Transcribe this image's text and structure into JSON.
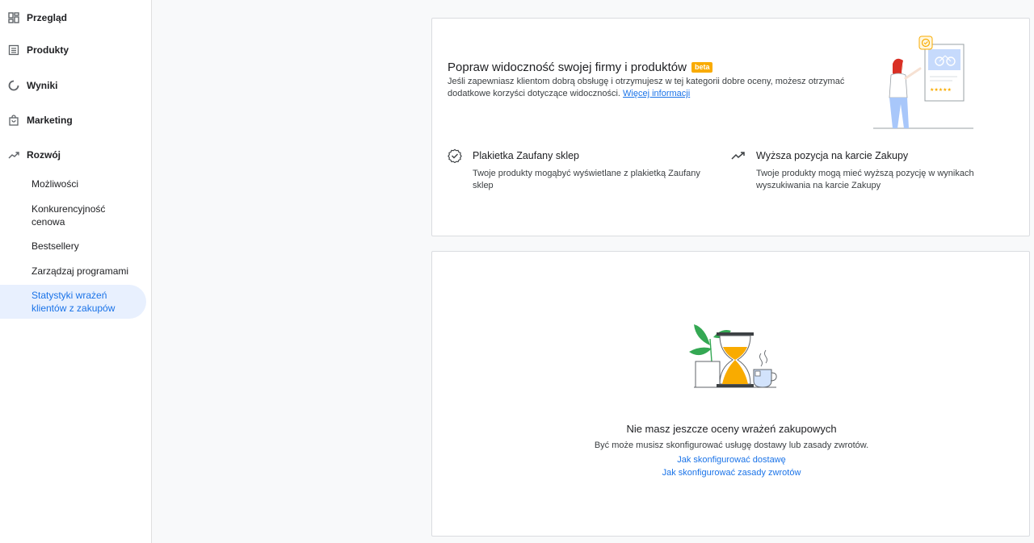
{
  "sidebar": {
    "items": [
      {
        "label": "Przegląd",
        "icon": "dashboard-icon"
      },
      {
        "label": "Produkty",
        "icon": "list-icon"
      },
      {
        "label": "Wyniki",
        "icon": "progress-circle-icon"
      },
      {
        "label": "Marketing",
        "icon": "shopping-bag-icon"
      },
      {
        "label": "Rozwój",
        "icon": "trending-up-icon"
      }
    ],
    "sub_items": [
      {
        "label": "Możliwości"
      },
      {
        "label": "Konkurencyjność cenowa"
      },
      {
        "label": "Bestsellery"
      },
      {
        "label": "Zarządzaj programami"
      },
      {
        "label": "Statystyki wrażeń klientów z zakupów"
      }
    ]
  },
  "visibility_card": {
    "title": "Popraw widoczność swojej firmy i produktów",
    "badge": "beta",
    "description": "Jeśli zapewniasz klientom dobrą obsługę i otrzymujesz w tej kategorii dobre oceny, możesz otrzymać dodatkowe korzyści dotyczące widoczności.",
    "learn_more": "Więcej informacji",
    "features": [
      {
        "title": "Plakietka Zaufany sklep",
        "description": "Twoje produkty mogąbyć wyświetlane z plakietką Zaufany sklep",
        "icon": "verified-badge-icon"
      },
      {
        "title": "Wyższa pozycja na karcie Zakupy",
        "description": "Twoje produkty mogą mieć wyższą pozycję w wynikach wyszukiwania na karcie Zakupy",
        "icon": "trending-up-icon"
      }
    ]
  },
  "empty_card": {
    "title": "Nie masz jeszcze oceny wrażeń zakupowych",
    "description": "Być może musisz skonfigurować usługę dostawy lub zasady zwrotów.",
    "link_shipping": "Jak skonfigurować dostawę",
    "link_returns": "Jak skonfigurować zasady zwrotów"
  },
  "colors": {
    "accent": "#1a73e8",
    "active_bg": "#e8f0fe",
    "badge": "#f9ab00",
    "hourglass": "#f9ab00",
    "plant": "#34a853"
  }
}
